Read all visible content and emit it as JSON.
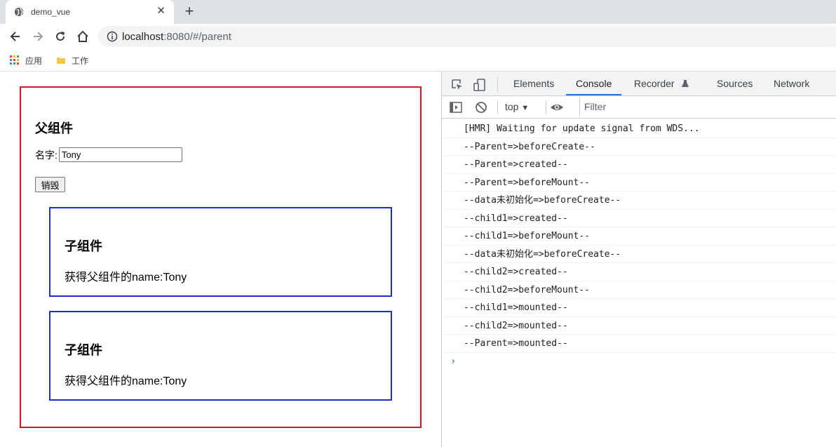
{
  "browser": {
    "tab_title": "demo_vue",
    "tab_close": "✕",
    "new_tab": "+",
    "url_host": "localhost",
    "url_rest": ":8080/#/parent",
    "bookmarks": [
      {
        "label": "应用",
        "icon": "apps-grid-icon"
      },
      {
        "label": "工作",
        "icon": "folder-icon"
      }
    ]
  },
  "page": {
    "parent_title": "父组件",
    "name_label": "名字:",
    "name_value": "Tony",
    "destroy_label": "销毁",
    "children": [
      {
        "title": "子组件",
        "text": "获得父组件的name:Tony"
      },
      {
        "title": "子组件",
        "text": "获得父组件的name:Tony"
      }
    ],
    "colors": {
      "parent_border": "#d01a2a",
      "child_border": "#1b2fd0"
    }
  },
  "devtools": {
    "tabs": [
      "Elements",
      "Console",
      "Recorder",
      "Sources",
      "Network"
    ],
    "active_tab": "Console",
    "context": "top",
    "filter_placeholder": "Filter",
    "console_lines": [
      "[HMR] Waiting for update signal from WDS...",
      "--Parent=>beforeCreate--",
      "--Parent=>created--",
      "--Parent=>beforeMount--",
      "--data未初始化=>beforeCreate--",
      "--child1=>created--",
      "--child1=>beforeMount--",
      "--data未初始化=>beforeCreate--",
      "--child2=>created--",
      "--child2=>beforeMount--",
      "--child1=>mounted--",
      "--child2=>mounted--",
      "--Parent=>mounted--"
    ],
    "prompt": "›"
  }
}
